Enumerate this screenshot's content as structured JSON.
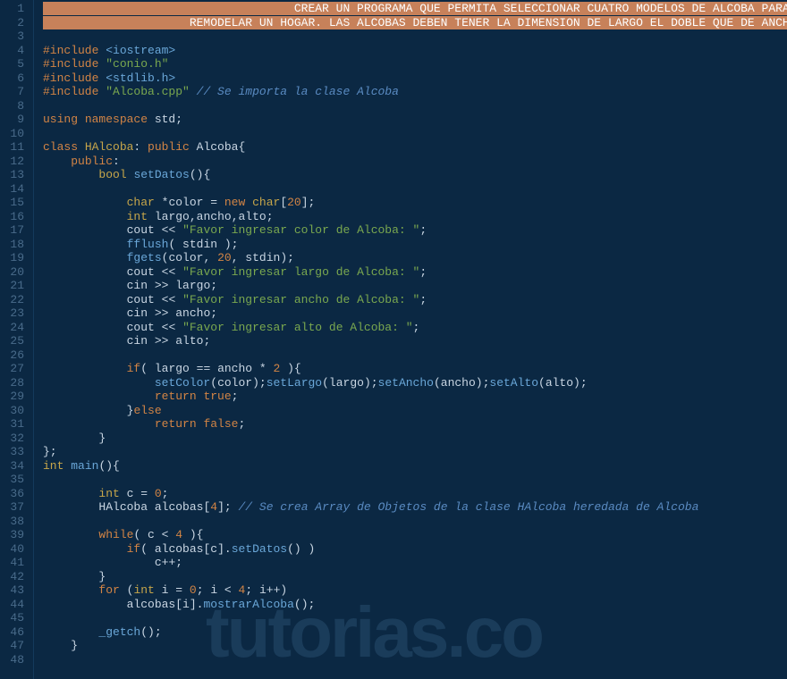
{
  "watermark": "tutorias.co",
  "gutter": [
    "1",
    "2",
    "3",
    "4",
    "5",
    "6",
    "7",
    "8",
    "9",
    "10",
    "11",
    "12",
    "13",
    "14",
    "15",
    "16",
    "17",
    "18",
    "19",
    "20",
    "21",
    "22",
    "23",
    "24",
    "25",
    "26",
    "27",
    "28",
    "29",
    "30",
    "31",
    "32",
    "33",
    "34",
    "35",
    "36",
    "37",
    "38",
    "39",
    "40",
    "41",
    "42",
    "43",
    "44",
    "45",
    "46",
    "47",
    "48"
  ],
  "lines": [
    [
      [
        "banner",
        "                                    CREAR UN PROGRAMA QUE PERMITA SELECCIONAR CUATRO MODELOS DE ALCOBA PARA"
      ]
    ],
    [
      [
        "banner",
        "                     REMODELAR UN HOGAR. LAS ALCOBAS DEBEN TENER LA DIMENSION DE LARGO EL DOBLE QUE DE ANCHO"
      ]
    ],
    [
      [
        "plain",
        ""
      ]
    ],
    [
      [
        "keyword",
        "#include "
      ],
      [
        "include",
        "<iostream>"
      ]
    ],
    [
      [
        "keyword",
        "#include "
      ],
      [
        "string",
        "\"conio.h\""
      ]
    ],
    [
      [
        "keyword",
        "#include "
      ],
      [
        "include",
        "<stdlib.h>"
      ]
    ],
    [
      [
        "keyword",
        "#include "
      ],
      [
        "string",
        "\"Alcoba.cpp\""
      ],
      [
        "plain",
        " "
      ],
      [
        "comment",
        "// Se importa la clase Alcoba"
      ]
    ],
    [
      [
        "plain",
        ""
      ]
    ],
    [
      [
        "keyword",
        "using "
      ],
      [
        "keyword",
        "namespace "
      ],
      [
        "ident",
        "std"
      ],
      [
        "punc",
        ";"
      ]
    ],
    [
      [
        "plain",
        ""
      ]
    ],
    [
      [
        "keyword",
        "class "
      ],
      [
        "class",
        "HAlcoba"
      ],
      [
        "punc",
        ": "
      ],
      [
        "keyword",
        "public "
      ],
      [
        "ident",
        "Alcoba"
      ],
      [
        "punc",
        "{"
      ]
    ],
    [
      [
        "plain",
        "    "
      ],
      [
        "keyword",
        "public"
      ],
      [
        "punc",
        ":"
      ]
    ],
    [
      [
        "plain",
        "        "
      ],
      [
        "type",
        "bool "
      ],
      [
        "func",
        "setDatos"
      ],
      [
        "punc",
        "(){"
      ]
    ],
    [
      [
        "plain",
        ""
      ]
    ],
    [
      [
        "plain",
        "            "
      ],
      [
        "type",
        "char "
      ],
      [
        "op",
        "*"
      ],
      [
        "ident",
        "color"
      ],
      [
        "op",
        " = "
      ],
      [
        "keyword",
        "new "
      ],
      [
        "type",
        "char"
      ],
      [
        "punc",
        "["
      ],
      [
        "num",
        "20"
      ],
      [
        "punc",
        "];"
      ]
    ],
    [
      [
        "plain",
        "            "
      ],
      [
        "type",
        "int "
      ],
      [
        "ident",
        "largo"
      ],
      [
        "punc",
        ","
      ],
      [
        "ident",
        "ancho"
      ],
      [
        "punc",
        ","
      ],
      [
        "ident",
        "alto"
      ],
      [
        "punc",
        ";"
      ]
    ],
    [
      [
        "plain",
        "            "
      ],
      [
        "ident",
        "cout"
      ],
      [
        "op",
        " << "
      ],
      [
        "string",
        "\"Favor ingresar color de Alcoba: \""
      ],
      [
        "punc",
        ";"
      ]
    ],
    [
      [
        "plain",
        "            "
      ],
      [
        "func",
        "fflush"
      ],
      [
        "punc",
        "( "
      ],
      [
        "ident",
        "stdin"
      ],
      [
        "punc",
        " );"
      ]
    ],
    [
      [
        "plain",
        "            "
      ],
      [
        "func",
        "fgets"
      ],
      [
        "punc",
        "("
      ],
      [
        "ident",
        "color"
      ],
      [
        "punc",
        ", "
      ],
      [
        "num",
        "20"
      ],
      [
        "punc",
        ", "
      ],
      [
        "ident",
        "stdin"
      ],
      [
        "punc",
        ");"
      ]
    ],
    [
      [
        "plain",
        "            "
      ],
      [
        "ident",
        "cout"
      ],
      [
        "op",
        " << "
      ],
      [
        "string",
        "\"Favor ingresar largo de Alcoba: \""
      ],
      [
        "punc",
        ";"
      ]
    ],
    [
      [
        "plain",
        "            "
      ],
      [
        "ident",
        "cin"
      ],
      [
        "op",
        " >> "
      ],
      [
        "ident",
        "largo"
      ],
      [
        "punc",
        ";"
      ]
    ],
    [
      [
        "plain",
        "            "
      ],
      [
        "ident",
        "cout"
      ],
      [
        "op",
        " << "
      ],
      [
        "string",
        "\"Favor ingresar ancho de Alcoba: \""
      ],
      [
        "punc",
        ";"
      ]
    ],
    [
      [
        "plain",
        "            "
      ],
      [
        "ident",
        "cin"
      ],
      [
        "op",
        " >> "
      ],
      [
        "ident",
        "ancho"
      ],
      [
        "punc",
        ";"
      ]
    ],
    [
      [
        "plain",
        "            "
      ],
      [
        "ident",
        "cout"
      ],
      [
        "op",
        " << "
      ],
      [
        "string",
        "\"Favor ingresar alto de Alcoba: \""
      ],
      [
        "punc",
        ";"
      ]
    ],
    [
      [
        "plain",
        "            "
      ],
      [
        "ident",
        "cin"
      ],
      [
        "op",
        " >> "
      ],
      [
        "ident",
        "alto"
      ],
      [
        "punc",
        ";"
      ]
    ],
    [
      [
        "plain",
        ""
      ]
    ],
    [
      [
        "plain",
        "            "
      ],
      [
        "keyword",
        "if"
      ],
      [
        "punc",
        "( "
      ],
      [
        "ident",
        "largo"
      ],
      [
        "op",
        " == "
      ],
      [
        "ident",
        "ancho"
      ],
      [
        "op",
        " * "
      ],
      [
        "num",
        "2"
      ],
      [
        "punc",
        " ){"
      ]
    ],
    [
      [
        "plain",
        "                "
      ],
      [
        "func",
        "setColor"
      ],
      [
        "punc",
        "("
      ],
      [
        "ident",
        "color"
      ],
      [
        "punc",
        ");"
      ],
      [
        "func",
        "setLargo"
      ],
      [
        "punc",
        "("
      ],
      [
        "ident",
        "largo"
      ],
      [
        "punc",
        ");"
      ],
      [
        "func",
        "setAncho"
      ],
      [
        "punc",
        "("
      ],
      [
        "ident",
        "ancho"
      ],
      [
        "punc",
        ");"
      ],
      [
        "func",
        "setAlto"
      ],
      [
        "punc",
        "("
      ],
      [
        "ident",
        "alto"
      ],
      [
        "punc",
        ");"
      ]
    ],
    [
      [
        "plain",
        "                "
      ],
      [
        "keyword",
        "return "
      ],
      [
        "bool",
        "true"
      ],
      [
        "punc",
        ";"
      ]
    ],
    [
      [
        "plain",
        "            "
      ],
      [
        "punc",
        "}"
      ],
      [
        "keyword",
        "else"
      ]
    ],
    [
      [
        "plain",
        "                "
      ],
      [
        "keyword",
        "return "
      ],
      [
        "bool",
        "false"
      ],
      [
        "punc",
        ";"
      ]
    ],
    [
      [
        "plain",
        "        "
      ],
      [
        "punc",
        "}"
      ]
    ],
    [
      [
        "punc",
        "};"
      ]
    ],
    [
      [
        "type",
        "int "
      ],
      [
        "func",
        "main"
      ],
      [
        "punc",
        "(){"
      ]
    ],
    [
      [
        "plain",
        ""
      ]
    ],
    [
      [
        "plain",
        "        "
      ],
      [
        "type",
        "int "
      ],
      [
        "ident",
        "c"
      ],
      [
        "op",
        " = "
      ],
      [
        "num",
        "0"
      ],
      [
        "punc",
        ";"
      ]
    ],
    [
      [
        "plain",
        "        "
      ],
      [
        "ident",
        "HAlcoba "
      ],
      [
        "ident",
        "alcobas"
      ],
      [
        "punc",
        "["
      ],
      [
        "num",
        "4"
      ],
      [
        "punc",
        "]; "
      ],
      [
        "comment",
        "// Se crea Array de Objetos de la clase HAlcoba heredada de Alcoba"
      ]
    ],
    [
      [
        "plain",
        ""
      ]
    ],
    [
      [
        "plain",
        "        "
      ],
      [
        "keyword",
        "while"
      ],
      [
        "punc",
        "( "
      ],
      [
        "ident",
        "c"
      ],
      [
        "op",
        " < "
      ],
      [
        "num",
        "4"
      ],
      [
        "punc",
        " ){"
      ]
    ],
    [
      [
        "plain",
        "            "
      ],
      [
        "keyword",
        "if"
      ],
      [
        "punc",
        "( "
      ],
      [
        "ident",
        "alcobas"
      ],
      [
        "punc",
        "["
      ],
      [
        "ident",
        "c"
      ],
      [
        "punc",
        "]."
      ],
      [
        "func",
        "setDatos"
      ],
      [
        "punc",
        "() )"
      ]
    ],
    [
      [
        "plain",
        "                "
      ],
      [
        "ident",
        "c"
      ],
      [
        "op",
        "++"
      ],
      [
        "punc",
        ";"
      ]
    ],
    [
      [
        "plain",
        "        "
      ],
      [
        "punc",
        "}"
      ]
    ],
    [
      [
        "plain",
        "        "
      ],
      [
        "keyword",
        "for "
      ],
      [
        "punc",
        "("
      ],
      [
        "type",
        "int "
      ],
      [
        "ident",
        "i"
      ],
      [
        "op",
        " = "
      ],
      [
        "num",
        "0"
      ],
      [
        "punc",
        "; "
      ],
      [
        "ident",
        "i"
      ],
      [
        "op",
        " < "
      ],
      [
        "num",
        "4"
      ],
      [
        "punc",
        "; "
      ],
      [
        "ident",
        "i"
      ],
      [
        "op",
        "++"
      ],
      [
        "punc",
        ")"
      ]
    ],
    [
      [
        "plain",
        "            "
      ],
      [
        "ident",
        "alcobas"
      ],
      [
        "punc",
        "["
      ],
      [
        "ident",
        "i"
      ],
      [
        "punc",
        "]."
      ],
      [
        "func",
        "mostrarAlcoba"
      ],
      [
        "punc",
        "();"
      ]
    ],
    [
      [
        "plain",
        ""
      ]
    ],
    [
      [
        "plain",
        "        "
      ],
      [
        "func",
        "_getch"
      ],
      [
        "punc",
        "();"
      ]
    ],
    [
      [
        "plain",
        "    "
      ],
      [
        "punc",
        "}"
      ]
    ],
    [
      [
        "plain",
        ""
      ]
    ]
  ]
}
